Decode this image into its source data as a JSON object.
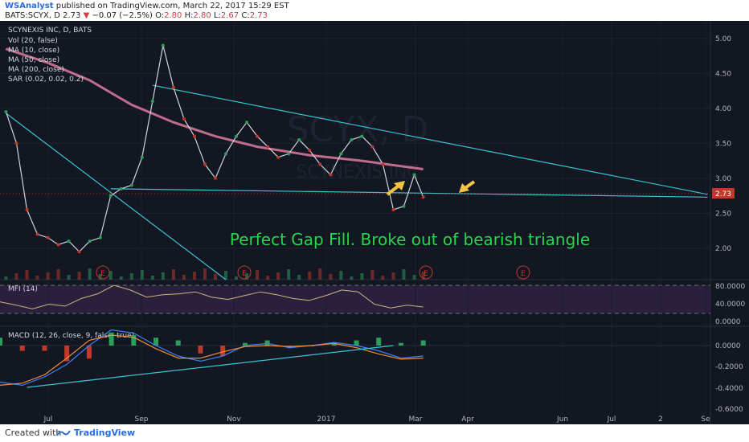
{
  "header": {
    "author": "WSAnalyst",
    "published": "published on TradingView.com, March 22, 2017 15:29 EST",
    "symbol": "BATS:SCYX, D",
    "last": "2.73",
    "change_arrow": "▼",
    "change": "−0.07 (−2.5%)",
    "o_label": "O:",
    "o_value": "2.80",
    "h_label": "H:",
    "h_value": "2.80",
    "l_label": "L:",
    "l_value": "2.67",
    "c_label": "C:",
    "c_value": "2.73"
  },
  "legend": {
    "title": "SCYNEXIS INC, D, BATS",
    "lines": [
      "Vol (20, false)",
      "MA (10, close)",
      "MA (50, close)",
      "MA (200, close)",
      "SAR (0.02, 0.02, 0.2)"
    ]
  },
  "watermark": {
    "symbol": "SCYX, D",
    "name": "SCYNEXIS INC"
  },
  "annotation": "Perfect Gap Fill. Broke out of bearish triangle",
  "last_price_tag": "2.73",
  "earnings_label": "E",
  "mfi": {
    "label": "MFI (14)",
    "ticks": [
      "80.0000",
      "40.0000",
      "0.0000"
    ]
  },
  "macd": {
    "label": "MACD (12, 26, close, 9, false, true)",
    "ticks": [
      "0.0000",
      "-0.2000",
      "-0.4000",
      "-0.6000"
    ]
  },
  "footer": {
    "created": "Created with",
    "brand": "TradingView"
  },
  "colors": {
    "bg": "#131722",
    "up": "#2e9e5b",
    "down": "#c0392b",
    "ma200": "#c06c8c",
    "trend": "#39c3d4",
    "annotation": "#27d64a",
    "arrow": "#f5c542"
  },
  "chart_data": {
    "type": "line",
    "price_axis": {
      "ticks": [
        5.0,
        4.5,
        4.0,
        3.5,
        3.0,
        2.5,
        2.0
      ],
      "tick_labels": [
        "5.00",
        "4.50",
        "4.00",
        "3.50",
        "3.00",
        "2.50",
        "2.00"
      ],
      "range": [
        1.55,
        5.25
      ]
    },
    "x_axis": {
      "ticks": [
        "Jul",
        "Sep",
        "Nov",
        "2017",
        "Mar",
        "Apr",
        "Jun",
        "Jul",
        "2",
        "Se"
      ]
    },
    "price_series": [
      {
        "d": "2016-06-16",
        "c": 3.95
      },
      {
        "d": "2016-06-23",
        "c": 3.5
      },
      {
        "d": "2016-06-30",
        "c": 2.55
      },
      {
        "d": "2016-07-07",
        "c": 2.2
      },
      {
        "d": "2016-07-14",
        "c": 2.15
      },
      {
        "d": "2016-07-21",
        "c": 2.05
      },
      {
        "d": "2016-07-28",
        "c": 2.1
      },
      {
        "d": "2016-08-04",
        "c": 1.95
      },
      {
        "d": "2016-08-11",
        "c": 2.1
      },
      {
        "d": "2016-08-18",
        "c": 2.15
      },
      {
        "d": "2016-08-25",
        "c": 2.75
      },
      {
        "d": "2016-09-01",
        "c": 2.85
      },
      {
        "d": "2016-09-08",
        "c": 2.9
      },
      {
        "d": "2016-09-15",
        "c": 3.3
      },
      {
        "d": "2016-09-22",
        "c": 4.1
      },
      {
        "d": "2016-09-29",
        "c": 4.9
      },
      {
        "d": "2016-10-06",
        "c": 4.3
      },
      {
        "d": "2016-10-13",
        "c": 3.85
      },
      {
        "d": "2016-10-20",
        "c": 3.6
      },
      {
        "d": "2016-10-27",
        "c": 3.2
      },
      {
        "d": "2016-11-03",
        "c": 3.0
      },
      {
        "d": "2016-11-10",
        "c": 3.35
      },
      {
        "d": "2016-11-17",
        "c": 3.6
      },
      {
        "d": "2016-11-24",
        "c": 3.8
      },
      {
        "d": "2016-12-01",
        "c": 3.6
      },
      {
        "d": "2016-12-08",
        "c": 3.45
      },
      {
        "d": "2016-12-15",
        "c": 3.3
      },
      {
        "d": "2016-12-22",
        "c": 3.35
      },
      {
        "d": "2016-12-29",
        "c": 3.55
      },
      {
        "d": "2017-01-05",
        "c": 3.4
      },
      {
        "d": "2017-01-12",
        "c": 3.2
      },
      {
        "d": "2017-01-19",
        "c": 3.05
      },
      {
        "d": "2017-01-26",
        "c": 3.35
      },
      {
        "d": "2017-02-02",
        "c": 3.55
      },
      {
        "d": "2017-02-09",
        "c": 3.6
      },
      {
        "d": "2017-02-16",
        "c": 3.45
      },
      {
        "d": "2017-02-23",
        "c": 3.2
      },
      {
        "d": "2017-03-02",
        "c": 2.55
      },
      {
        "d": "2017-03-09",
        "c": 2.6
      },
      {
        "d": "2017-03-16",
        "c": 3.05
      },
      {
        "d": "2017-03-22",
        "c": 2.73
      }
    ],
    "ma200_series": [
      {
        "d": "2016-06-16",
        "v": 4.85
      },
      {
        "d": "2016-07-14",
        "v": 4.65
      },
      {
        "d": "2016-08-11",
        "v": 4.4
      },
      {
        "d": "2016-09-08",
        "v": 4.05
      },
      {
        "d": "2016-10-06",
        "v": 3.8
      },
      {
        "d": "2016-11-03",
        "v": 3.6
      },
      {
        "d": "2016-12-01",
        "v": 3.45
      },
      {
        "d": "2017-01-05",
        "v": 3.33
      },
      {
        "d": "2017-02-09",
        "v": 3.25
      },
      {
        "d": "2017-03-22",
        "v": 3.13
      }
    ],
    "trendlines": [
      {
        "from": {
          "d": "2016-09-22",
          "v": 4.33
        },
        "to": {
          "d": "2017-09-28",
          "v": 2.77
        }
      },
      {
        "from": {
          "d": "2016-08-25",
          "v": 2.85
        },
        "to": {
          "d": "2017-09-28",
          "v": 2.73
        }
      },
      {
        "from": {
          "d": "2016-06-16",
          "v": 3.93
        },
        "to": {
          "d": "2016-11-10",
          "v": 1.55
        }
      }
    ],
    "mfi_series": [
      45,
      38,
      30,
      40,
      36,
      52,
      62,
      80,
      70,
      55,
      60,
      62,
      66,
      55,
      50,
      58,
      66,
      60,
      52,
      48,
      58,
      70,
      66,
      40,
      32,
      38,
      34
    ],
    "macd_series": [
      -0.35,
      -0.38,
      -0.3,
      -0.18,
      0.0,
      0.15,
      0.12,
      0.0,
      -0.1,
      -0.15,
      -0.1,
      0.0,
      0.02,
      -0.02,
      0.0,
      0.03,
      0.0,
      -0.05,
      -0.12,
      -0.1
    ],
    "signal_series": [
      -0.38,
      -0.36,
      -0.28,
      -0.12,
      0.05,
      0.1,
      0.08,
      -0.03,
      -0.12,
      -0.12,
      -0.06,
      -0.01,
      0.0,
      -0.01,
      0.0,
      0.02,
      -0.02,
      -0.08,
      -0.13,
      -0.12
    ],
    "macd_trendline": {
      "from": {
        "d": "2016-06-30",
        "v": -0.4
      },
      "to": {
        "d": "2017-03-02",
        "v": 0.0
      }
    }
  }
}
